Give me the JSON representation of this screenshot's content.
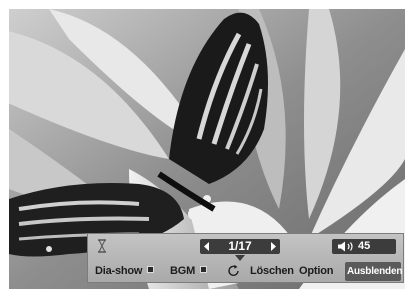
{
  "slideshow_toolbar": {
    "page_counter": "1/17",
    "volume": "45",
    "buttons": {
      "slideshow": "Dia-show",
      "bgm": "BGM",
      "delete": "Löschen",
      "option": "Option",
      "hide": "Ausblenden"
    }
  },
  "colors": {
    "toolbar_bg": "#b5b5b5",
    "dark_box": "#3c3c3c",
    "highlight": "#5a5a5a"
  },
  "icons": [
    "hourglass-icon",
    "prev-icon",
    "next-icon",
    "down-arrow-icon",
    "speaker-icon",
    "square-icon",
    "repeat-icon"
  ]
}
